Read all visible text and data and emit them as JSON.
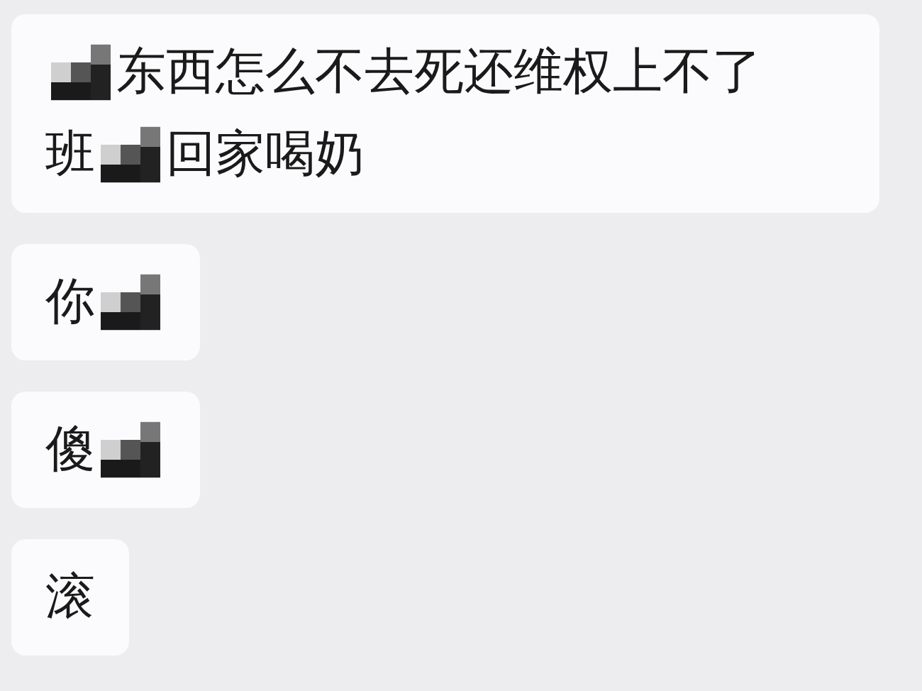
{
  "messages": [
    {
      "lines": [
        [
          {
            "kind": "mosaic"
          },
          {
            "kind": "text",
            "text": "东西怎么不去死还维权上不了"
          }
        ],
        [
          {
            "kind": "text",
            "text": "班"
          },
          {
            "kind": "mosaic"
          },
          {
            "kind": "text",
            "text": "回家喝奶"
          }
        ]
      ]
    },
    {
      "lines": [
        [
          {
            "kind": "text",
            "text": "你"
          },
          {
            "kind": "mosaic"
          }
        ]
      ]
    },
    {
      "lines": [
        [
          {
            "kind": "text",
            "text": "傻"
          },
          {
            "kind": "mosaic"
          }
        ]
      ]
    },
    {
      "lines": [
        [
          {
            "kind": "text",
            "text": "滚"
          }
        ]
      ]
    }
  ]
}
